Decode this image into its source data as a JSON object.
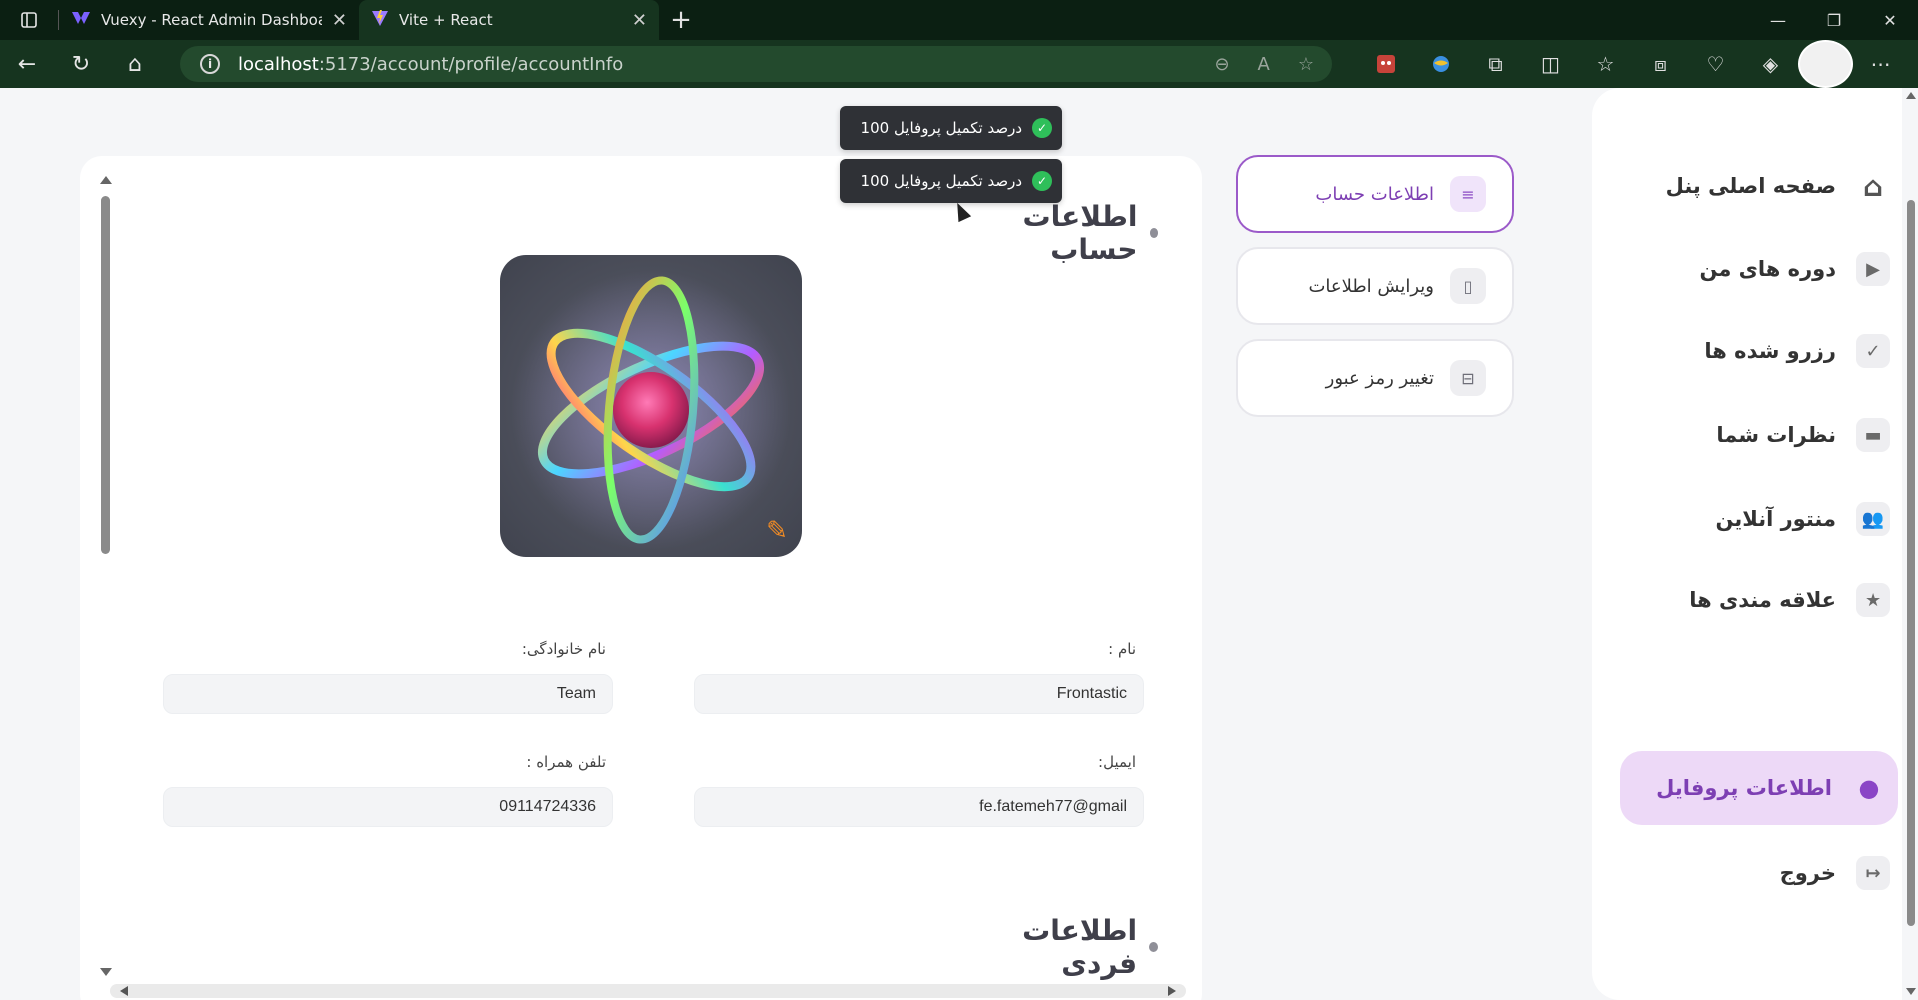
{
  "browser": {
    "tabs": [
      {
        "title": "Vuexy - React Admin Dashboard",
        "icon": "vuexy-icon"
      },
      {
        "title": "Vite + React",
        "icon": "vite-icon"
      }
    ],
    "address": {
      "host": "localhost",
      "path": ":5173/account/profile/accountInfo"
    }
  },
  "toasts": [
    {
      "text": "درصد تکمیل پروفایل 100"
    },
    {
      "text": "درصد تکمیل پروفایل 100"
    }
  ],
  "main": {
    "account_title": "اطلاعات حساب",
    "personal_title": "اطلاعات فردی",
    "fields": {
      "first_name": {
        "label": "نام :",
        "value": "Frontastic"
      },
      "last_name": {
        "label": "نام خانوادگی:",
        "value": "Team"
      },
      "email": {
        "label": "ایمیل:",
        "value": "fe.fatemeh77@gmail"
      },
      "phone": {
        "label": "تلفن همراه :",
        "value": "09114724336"
      }
    }
  },
  "submenu": {
    "items": [
      {
        "label": "اطلاعات حساب",
        "icon": "list-icon",
        "active": true
      },
      {
        "label": "ویرایش اطلاعات",
        "icon": "phone-icon",
        "active": false
      },
      {
        "label": "تغییر رمز عبور",
        "icon": "password-icon",
        "active": false
      }
    ]
  },
  "sidebar": {
    "items": [
      {
        "label": "صفحه اصلی پنل",
        "icon": "home-icon"
      },
      {
        "label": "دوره های من",
        "icon": "video-icon"
      },
      {
        "label": "رزرو شده ها",
        "icon": "bookmark-check-icon"
      },
      {
        "label": "نظرات شما",
        "icon": "comment-icon"
      },
      {
        "label": "منتور آنلاین",
        "icon": "users-icon"
      },
      {
        "label": "علاقه مندی ها",
        "icon": "star-icon"
      },
      {
        "label": "اطلاعات پروفایل",
        "icon": "user-icon"
      },
      {
        "label": "خروج",
        "icon": "logout-icon"
      }
    ]
  },
  "colors": {
    "accent": "#8a45c6",
    "accent_bg": "#edd9f7",
    "toast_bg": "#2f3136",
    "toast_check": "#2fbf5a"
  }
}
